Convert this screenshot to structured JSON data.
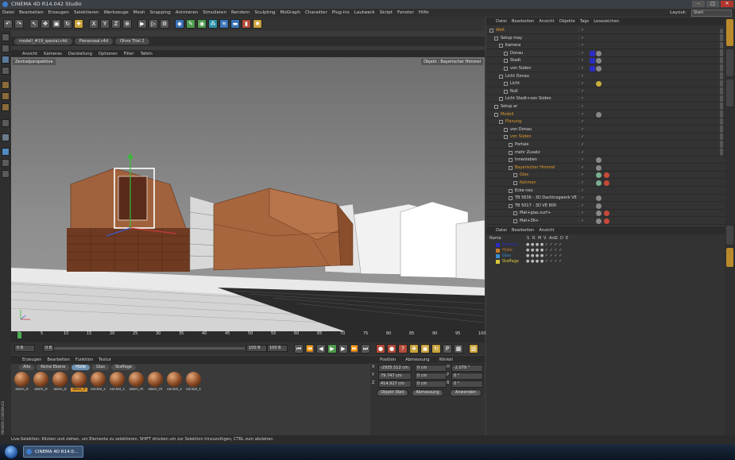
{
  "window": {
    "title": "CINEMA 4D R14.042 Studio"
  },
  "menu": [
    "Datei",
    "Bearbeiten",
    "Erzeugen",
    "Selektieren",
    "Werkzeuge",
    "Mesh",
    "Snapping",
    "Animieren",
    "Simulieren",
    "Rendern",
    "Sculpting",
    "MoGraph",
    "Charakter",
    "Plug-ins",
    "Lautwerk",
    "Skript",
    "Fenster",
    "Hilfe"
  ],
  "layout": {
    "label": "Layout:",
    "value": "Start"
  },
  "doc_tabs": [
    "modell_#19_spezial.c4d",
    "Plenarsaal.c4d",
    "Ohne Titel 2"
  ],
  "viewport": {
    "menu": [
      "Ansicht",
      "Kameras",
      "Darstellung",
      "Optionen",
      "Filter",
      "Tafeln"
    ],
    "camera_label": "Zentralperspektive",
    "object_label": "Objekt : Bayerischer Himmel"
  },
  "timeline": {
    "ticks": [
      "0",
      "5",
      "10",
      "15",
      "20",
      "25",
      "30",
      "35",
      "40",
      "45",
      "50",
      "55",
      "60",
      "65",
      "70",
      "75",
      "80",
      "85",
      "90",
      "95",
      "100"
    ],
    "frame_label": "0 B",
    "start_field": "0 B",
    "end_field": "100 B",
    "max_field": "100 B",
    "current_frame": "0 B"
  },
  "materials": {
    "menu": [
      "Erzeugen",
      "Bearbeiten",
      "Funktion",
      "Textur"
    ],
    "tabs": [
      "Alle",
      "Keine Ebene",
      "Hülle",
      "Glas",
      "Staffage"
    ],
    "active_tab": "Hülle",
    "items": [
      "oben_0",
      "oben_0",
      "oben_0",
      "oben_0",
      "sockel_s",
      "sockel_s",
      "oben_m",
      "oben_m",
      "sockel_s",
      "sockel_s"
    ]
  },
  "attributes": {
    "headers": [
      "Position",
      "Abmessung",
      "Winkel"
    ],
    "rows": [
      {
        "axis": "X",
        "pos": "-2935.512 cm",
        "size": "0 cm",
        "rot_label": "H",
        "rot": "-2.079 °"
      },
      {
        "axis": "Y",
        "pos": "79.747 cm",
        "size": "0 cm",
        "rot_label": "P",
        "rot": "0 °"
      },
      {
        "axis": "Z",
        "pos": "414.927 cm",
        "size": "0 cm",
        "rot_label": "B",
        "rot": "0 °"
      }
    ],
    "coord_mode": "Objekt (Rel)",
    "size_mode": "Abmessung",
    "apply": "Anwenden"
  },
  "object_manager": {
    "menu": [
      "Datei",
      "Bearbeiten",
      "Ansicht",
      "Objekte",
      "Tags",
      "Lesezeichen"
    ],
    "rows": [
      {
        "name": "Welt",
        "indent": 0,
        "color": "#e09a2a"
      },
      {
        "name": "Setup may",
        "indent": 1,
        "color": "#d8d8d8"
      },
      {
        "name": "Kamera",
        "indent": 2,
        "color": "#d8d8d8"
      },
      {
        "name": "Donau",
        "indent": 3,
        "color": "#d8d8d8"
      },
      {
        "name": "Stadt",
        "indent": 3,
        "color": "#d8d8d8"
      },
      {
        "name": "von Süden",
        "indent": 3,
        "color": "#d8d8d8"
      },
      {
        "name": "Licht Donau",
        "indent": 2,
        "color": "#d8d8d8"
      },
      {
        "name": "Licht",
        "indent": 3,
        "color": "#d8d8d8"
      },
      {
        "name": "Null",
        "indent": 3,
        "color": "#d8d8d8"
      },
      {
        "name": "Licht Stadt+von Süden",
        "indent": 2,
        "color": "#d8d8d8"
      },
      {
        "name": "Setup ar",
        "indent": 1,
        "color": "#d8d8d8"
      },
      {
        "name": "Modell",
        "indent": 1,
        "color": "#e09a2a"
      },
      {
        "name": "Planung",
        "indent": 2,
        "color": "#e09a2a"
      },
      {
        "name": "von Donau",
        "indent": 3,
        "color": "#d8d8d8"
      },
      {
        "name": "von Süden",
        "indent": 3,
        "color": "#e09a2a"
      },
      {
        "name": "Portale",
        "indent": 4,
        "color": "#d8d8d8"
      },
      {
        "name": "mehr Zusatz",
        "indent": 4,
        "color": "#d8d8d8"
      },
      {
        "name": "Innenleben",
        "indent": 4,
        "color": "#d8d8d8"
      },
      {
        "name": "Bayerischer Himmel",
        "indent": 4,
        "color": "#e09a2a"
      },
      {
        "name": "Glas",
        "indent": 5,
        "color": "#e09a2a"
      },
      {
        "name": "Rahmen",
        "indent": 5,
        "color": "#e09a2a"
      },
      {
        "name": "Ecke neu",
        "indent": 4,
        "color": "#d8d8d8"
      },
      {
        "name": "TB 5636 - 3D Dachtragwerk VE",
        "indent": 4,
        "color": "#d8d8d8"
      },
      {
        "name": "TB 5017 - 3D VE 800",
        "indent": 4,
        "color": "#d8d8d8"
      },
      {
        "name": "Mat+glas.surf+",
        "indent": 5,
        "color": "#d8d8d8"
      },
      {
        "name": "Mat+36+",
        "indent": 5,
        "color": "#d8d8d8"
      }
    ]
  },
  "layer_manager": {
    "menu": [
      "Datei",
      "Bearbeiten",
      "Ansicht"
    ],
    "headers": [
      "Name",
      "S",
      "R",
      "M",
      "V",
      "Ani",
      "G",
      "D",
      "E"
    ],
    "rows": [
      {
        "name": "Kamera",
        "color": "#2c2cc8"
      },
      {
        "name": "Hülle",
        "color": "#c87a2c"
      },
      {
        "name": "Glas",
        "color": "#3a8fd0"
      },
      {
        "name": "Staffage",
        "color": "#d8c83a"
      }
    ]
  },
  "status": "Live-Selektion: Klicken und ziehen, um Elemente zu selektieren. SHIFT drücken um zur Selektion hinzuzufügen, CTRL zum abziehen.",
  "taskbar": {
    "item": "CINEMA 4D R14.0...",
    "clock": ""
  },
  "side_brand": "MAXON CINEMA4D"
}
